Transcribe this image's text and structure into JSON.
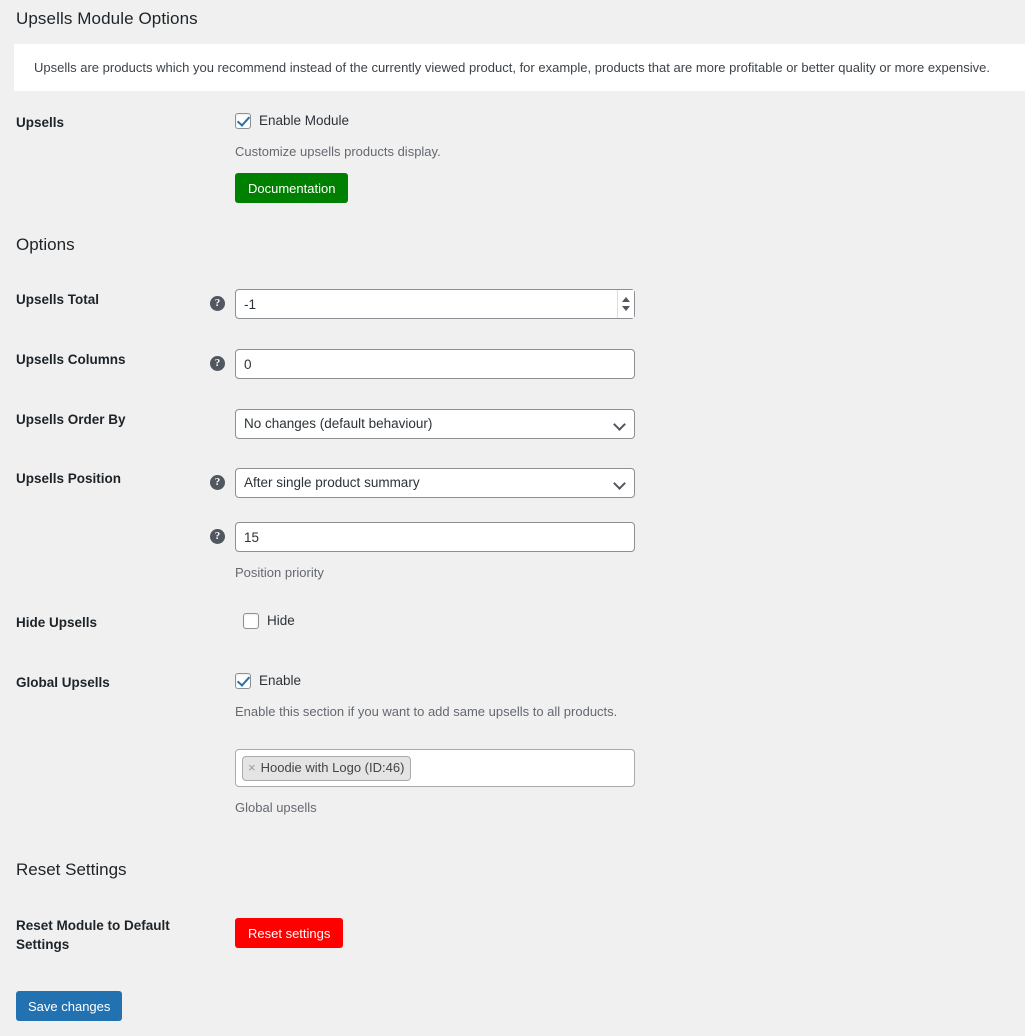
{
  "page": {
    "title": "Upsells Module Options",
    "notice": "Upsells are products which you recommend instead of the currently viewed product, for example, products that are more profitable or better quality or more expensive."
  },
  "icons": {
    "help": "?",
    "remove": "×"
  },
  "upsells_section": {
    "label": "Upsells",
    "enable_checkbox_label": "Enable Module",
    "enable_checked": true,
    "description": "Customize upsells products display.",
    "documentation_button": "Documentation"
  },
  "options_section": {
    "heading": "Options",
    "fields": {
      "upsells_total": {
        "label": "Upsells Total",
        "value": "-1",
        "type": "number"
      },
      "upsells_columns": {
        "label": "Upsells Columns",
        "value": "0",
        "type": "text"
      },
      "upsells_order_by": {
        "label": "Upsells Order By",
        "value": "No changes (default behaviour)",
        "type": "select"
      },
      "upsells_position": {
        "label": "Upsells Position",
        "value": "After single product summary",
        "type": "select"
      },
      "position_priority": {
        "value": "15",
        "description": "Position priority",
        "type": "text"
      },
      "hide_upsells": {
        "label": "Hide Upsells",
        "checkbox_label": "Hide",
        "checked": false
      },
      "global_upsells": {
        "label": "Global Upsells",
        "checkbox_label": "Enable",
        "checked": true,
        "description": "Enable this section if you want to add same upsells to all products.",
        "tokens": [
          "Hoodie with Logo (ID:46)"
        ],
        "field_description": "Global upsells"
      }
    }
  },
  "reset_section": {
    "heading": "Reset Settings",
    "label": "Reset Module to Default Settings",
    "button": "Reset settings"
  },
  "footer": {
    "save_button": "Save changes"
  },
  "colors": {
    "background": "#f0f0f1",
    "documentation_green": "#008000",
    "reset_red": "#ff0000",
    "save_blue": "#2271b1",
    "checkbox_blue": "#2271b1"
  }
}
